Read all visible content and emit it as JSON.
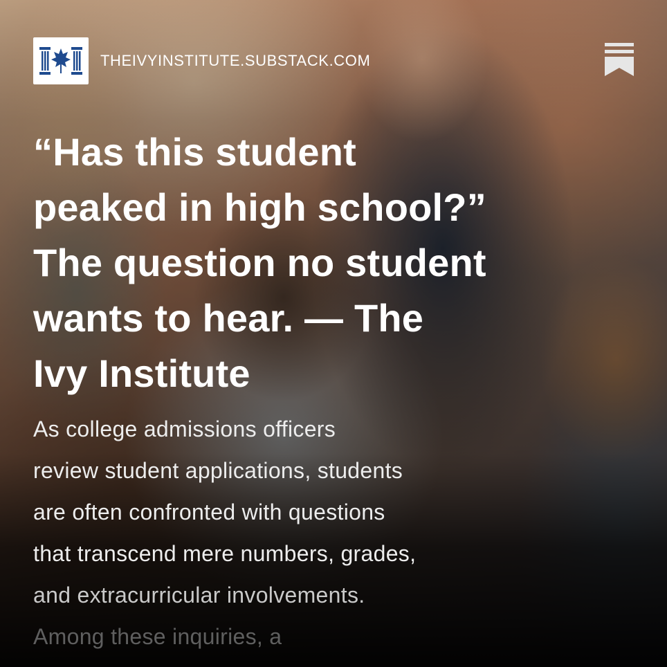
{
  "header": {
    "site_name": "THEIVYINSTITUTE.SUBSTACK.COM",
    "logo_icon": "ivy-institute-logo-icon",
    "bookmark_icon": "substack-bookmark-icon"
  },
  "post": {
    "title_lines": [
      "“Has this student",
      "peaked in high school?”",
      "The question no student",
      "wants to hear. — The",
      "Ivy Institute"
    ],
    "excerpt_lines": [
      "As college admissions officers",
      "review student applications, students",
      "are often confronted with questions",
      "that transcend mere numbers, grades,",
      "and extracurricular involvements.",
      "Among these inquiries, a"
    ]
  },
  "colors": {
    "logo_blue": "#1f4b8f",
    "text": "#ffffff"
  }
}
